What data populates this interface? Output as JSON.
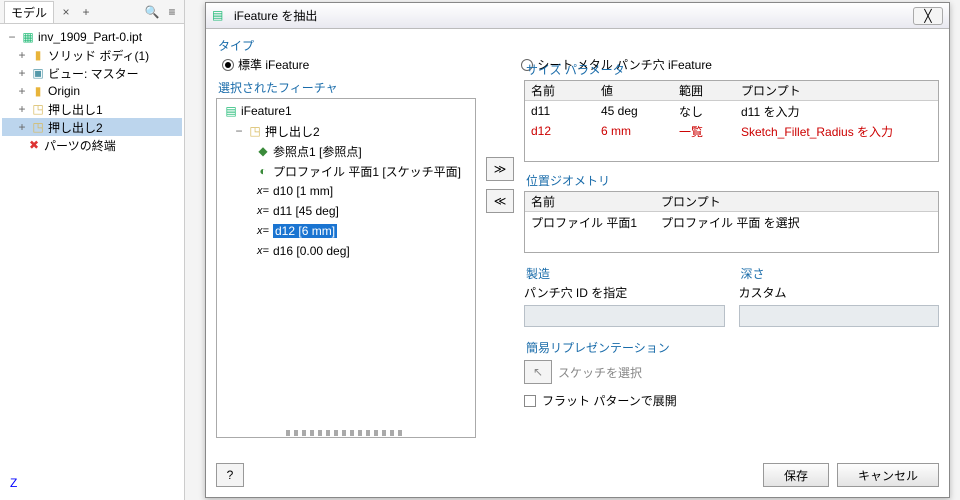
{
  "model_panel": {
    "tab_label": "モデル",
    "root": "inv_1909_Part-0.ipt",
    "nodes": [
      {
        "label": "ソリッド ボディ(1)",
        "icon": "folder"
      },
      {
        "label": "ビュー: マスター",
        "icon": "view"
      },
      {
        "label": "Origin",
        "icon": "folder"
      },
      {
        "label": "押し出し1",
        "icon": "extrude"
      },
      {
        "label": "押し出し2",
        "icon": "extrude",
        "selected": true
      },
      {
        "label": "パーツの終端",
        "icon": "stop"
      }
    ]
  },
  "axis_label": "Z",
  "dialog": {
    "title": "iFeature を抽出",
    "type_label": "タイプ",
    "type_options": {
      "std": "標準 iFeature",
      "sheet": "シート メタル パンチ穴 iFeature"
    },
    "type_selected": "std",
    "selected_features_label": "選択されたフィーチャ",
    "tree": {
      "root": "iFeature1",
      "child": "押し出し2",
      "leaves": [
        {
          "icon": "ref",
          "label": "参照点1 [参照点]"
        },
        {
          "icon": "profile",
          "label": "プロファイル 平面1 [スケッチ平面]"
        },
        {
          "icon": "param",
          "label": "d10 [1 mm]"
        },
        {
          "icon": "param",
          "label": "d11 [45 deg]"
        },
        {
          "icon": "param",
          "label": "d12 [6 mm]",
          "selected": true
        },
        {
          "icon": "param",
          "label": "d16 [0.00 deg]"
        }
      ]
    },
    "size_params": {
      "label": "サイズ パラメータ",
      "headers": {
        "name": "名前",
        "value": "値",
        "range": "範囲",
        "prompt": "プロンプト"
      },
      "rows": [
        {
          "name": "d11",
          "value": "45 deg",
          "range": "なし",
          "prompt": "d11 を入力",
          "hi": false
        },
        {
          "name": "d12",
          "value": "6 mm",
          "range": "一覧",
          "prompt": "Sketch_Fillet_Radius を入力",
          "hi": true
        }
      ]
    },
    "pos_geom": {
      "label": "位置ジオメトリ",
      "headers": {
        "name": "名前",
        "prompt": "プロンプト"
      },
      "rows": [
        {
          "name": "プロファイル 平面1",
          "prompt": "プロファイル 平面 を選択"
        }
      ]
    },
    "mfg": {
      "label": "製造",
      "sub": "パンチ穴 ID を指定",
      "value": ""
    },
    "depth": {
      "label": "深さ",
      "sub": "カスタム",
      "value": ""
    },
    "simple_rep": {
      "label": "簡易リプレゼンテーション",
      "pick": "スケッチを選択"
    },
    "flat_label": "フラット パターンで展開",
    "buttons": {
      "save": "保存",
      "cancel": "キャンセル"
    }
  },
  "icons": {
    "close_x": "╳",
    "search": "🔍",
    "menu": "≡",
    "plus": "+",
    "x": "×",
    "add_arrows": "≫",
    "remove_arrows": "≪",
    "help": "?"
  }
}
